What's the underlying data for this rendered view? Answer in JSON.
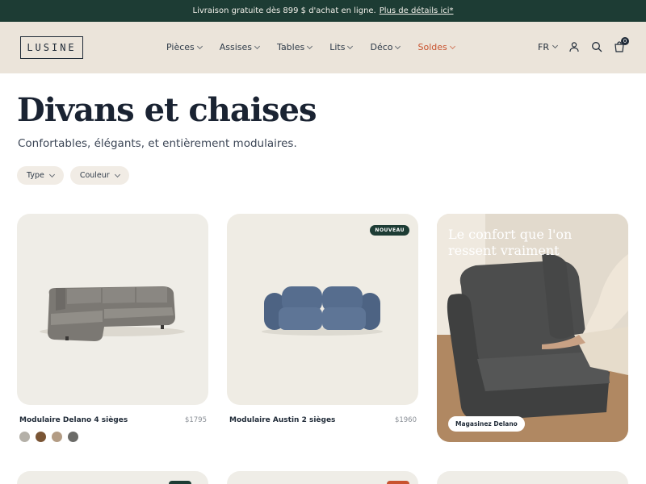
{
  "announcement": {
    "text": "Livraison gratuite dès 899 $ d'achat en ligne.",
    "link": "Plus de détails ici*"
  },
  "header": {
    "logo": "LUSINE",
    "nav": [
      {
        "label": "Pièces"
      },
      {
        "label": "Assises"
      },
      {
        "label": "Tables"
      },
      {
        "label": "Lits"
      },
      {
        "label": "Déco"
      },
      {
        "label": "Soldes"
      }
    ],
    "language": "FR",
    "cart_count": "0",
    "icons": [
      "account-icon",
      "search-icon",
      "cart-icon"
    ]
  },
  "page": {
    "title": "Divans et chaises",
    "subtitle": "Confortables, élégants, et entièrement modulaires."
  },
  "filters": [
    {
      "label": "Type"
    },
    {
      "label": "Couleur"
    }
  ],
  "products": [
    {
      "name": "Modulaire Delano 4 sièges",
      "price": "$1795",
      "swatches": [
        "#b4b0a8",
        "#7a5535",
        "#b39c84",
        "#6b6b68"
      ]
    },
    {
      "name": "Modulaire Austin 2 sièges",
      "price": "$1960",
      "badge": "NOUVEAU"
    }
  ],
  "promo": {
    "text": "Le confort que l'on ressent vraiment",
    "button": "Magasinez Delano"
  },
  "colors": {
    "brand_dark": "#1d3c34",
    "header_bg": "#ebe4da",
    "sale": "#c9532f"
  }
}
